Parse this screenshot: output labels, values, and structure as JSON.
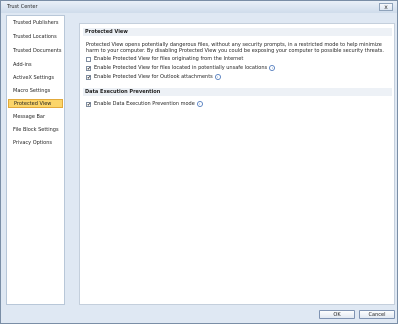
{
  "window": {
    "title": "Trust Center",
    "close_label": "x"
  },
  "sidebar": {
    "items": [
      {
        "label": "Trusted Publishers",
        "selected": false
      },
      {
        "label": "Trusted Locations",
        "selected": false
      },
      {
        "label": "Trusted Documents",
        "selected": false
      },
      {
        "label": "Add-ins",
        "selected": false
      },
      {
        "label": "ActiveX Settings",
        "selected": false
      },
      {
        "label": "Macro Settings",
        "selected": false
      },
      {
        "label": "Protected View",
        "selected": true
      },
      {
        "label": "Message Bar",
        "selected": false
      },
      {
        "label": "File Block Settings",
        "selected": false
      },
      {
        "label": "Privacy Options",
        "selected": false
      }
    ]
  },
  "protected_view": {
    "header": "Protected View",
    "description": "Protected View opens potentially dangerous files, without any security prompts, in a restricted mode to help minimize harm to your computer. By disabling Protected View you could be exposing your computer to possible security threats.",
    "options": [
      {
        "label": "Enable Protected View for files originating from the Internet",
        "checked": false,
        "info": false
      },
      {
        "label": "Enable Protected View for files located in potentially unsafe locations",
        "checked": true,
        "info": true
      },
      {
        "label": "Enable Protected View for Outlook attachments",
        "checked": true,
        "info": true
      }
    ]
  },
  "dep": {
    "header": "Data Execution Prevention",
    "options": [
      {
        "label": "Enable Data Execution Prevention mode",
        "checked": true,
        "info": true
      }
    ]
  },
  "buttons": {
    "ok": "OK",
    "cancel": "Cancel"
  },
  "icons": {
    "check": "✔",
    "info": "i"
  }
}
